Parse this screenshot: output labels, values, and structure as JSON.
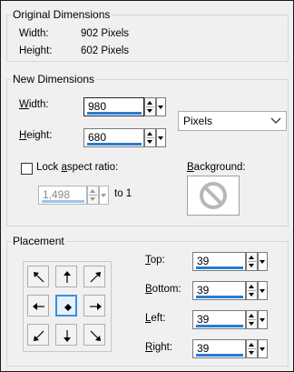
{
  "original": {
    "title": "Original Dimensions",
    "width_label": "Width:",
    "width_value": "902 Pixels",
    "height_label": "Height:",
    "height_value": "602 Pixels"
  },
  "new_dimensions": {
    "title": "New Dimensions",
    "width_label_key": "W",
    "width_label_rest": "idth:",
    "width_value": "980",
    "height_label_key": "H",
    "height_label_rest": "eight:",
    "height_value": "680",
    "units": "Pixels",
    "lock_label_pre": "Lock ",
    "lock_label_key": "a",
    "lock_label_rest": "spect ratio:",
    "lock_checked": false,
    "ratio_value": "1,498",
    "ratio_suffix": "to 1",
    "background_label_key": "B",
    "background_label_rest": "ackground:"
  },
  "placement": {
    "title": "Placement",
    "selected_anchor": "center",
    "top_label_key": "T",
    "top_label_rest": "op:",
    "top_value": "39",
    "bottom_label_key": "B",
    "bottom_label_rest": "ottom:",
    "bottom_value": "39",
    "left_label_key": "L",
    "left_label_rest": "eft:",
    "left_value": "39",
    "right_label_key": "R",
    "right_label_rest": "ight:",
    "right_value": "39"
  },
  "colors": {
    "accent_bar": "#2a7bd4",
    "selected_border": "#3b8fdf"
  }
}
